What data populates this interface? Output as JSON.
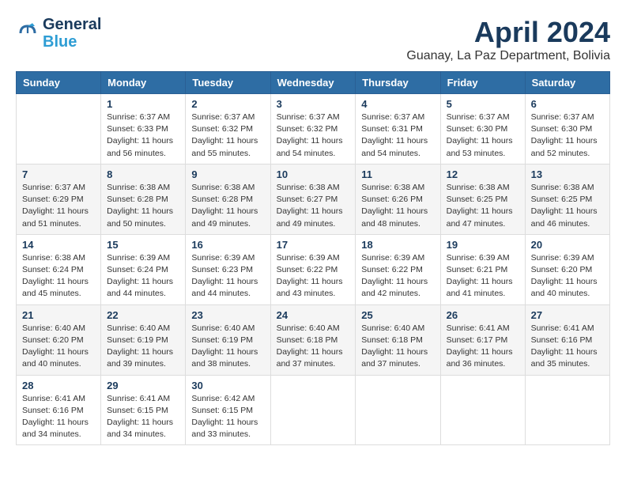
{
  "logo": {
    "line1": "General",
    "line2": "Blue"
  },
  "title": "April 2024",
  "location": "Guanay, La Paz Department, Bolivia",
  "days_of_week": [
    "Sunday",
    "Monday",
    "Tuesday",
    "Wednesday",
    "Thursday",
    "Friday",
    "Saturday"
  ],
  "weeks": [
    [
      {
        "day": "",
        "sunrise": "",
        "sunset": "",
        "daylight": ""
      },
      {
        "day": "1",
        "sunrise": "Sunrise: 6:37 AM",
        "sunset": "Sunset: 6:33 PM",
        "daylight": "Daylight: 11 hours and 56 minutes."
      },
      {
        "day": "2",
        "sunrise": "Sunrise: 6:37 AM",
        "sunset": "Sunset: 6:32 PM",
        "daylight": "Daylight: 11 hours and 55 minutes."
      },
      {
        "day": "3",
        "sunrise": "Sunrise: 6:37 AM",
        "sunset": "Sunset: 6:32 PM",
        "daylight": "Daylight: 11 hours and 54 minutes."
      },
      {
        "day": "4",
        "sunrise": "Sunrise: 6:37 AM",
        "sunset": "Sunset: 6:31 PM",
        "daylight": "Daylight: 11 hours and 54 minutes."
      },
      {
        "day": "5",
        "sunrise": "Sunrise: 6:37 AM",
        "sunset": "Sunset: 6:30 PM",
        "daylight": "Daylight: 11 hours and 53 minutes."
      },
      {
        "day": "6",
        "sunrise": "Sunrise: 6:37 AM",
        "sunset": "Sunset: 6:30 PM",
        "daylight": "Daylight: 11 hours and 52 minutes."
      }
    ],
    [
      {
        "day": "7",
        "sunrise": "Sunrise: 6:37 AM",
        "sunset": "Sunset: 6:29 PM",
        "daylight": "Daylight: 11 hours and 51 minutes."
      },
      {
        "day": "8",
        "sunrise": "Sunrise: 6:38 AM",
        "sunset": "Sunset: 6:28 PM",
        "daylight": "Daylight: 11 hours and 50 minutes."
      },
      {
        "day": "9",
        "sunrise": "Sunrise: 6:38 AM",
        "sunset": "Sunset: 6:28 PM",
        "daylight": "Daylight: 11 hours and 49 minutes."
      },
      {
        "day": "10",
        "sunrise": "Sunrise: 6:38 AM",
        "sunset": "Sunset: 6:27 PM",
        "daylight": "Daylight: 11 hours and 49 minutes."
      },
      {
        "day": "11",
        "sunrise": "Sunrise: 6:38 AM",
        "sunset": "Sunset: 6:26 PM",
        "daylight": "Daylight: 11 hours and 48 minutes."
      },
      {
        "day": "12",
        "sunrise": "Sunrise: 6:38 AM",
        "sunset": "Sunset: 6:25 PM",
        "daylight": "Daylight: 11 hours and 47 minutes."
      },
      {
        "day": "13",
        "sunrise": "Sunrise: 6:38 AM",
        "sunset": "Sunset: 6:25 PM",
        "daylight": "Daylight: 11 hours and 46 minutes."
      }
    ],
    [
      {
        "day": "14",
        "sunrise": "Sunrise: 6:38 AM",
        "sunset": "Sunset: 6:24 PM",
        "daylight": "Daylight: 11 hours and 45 minutes."
      },
      {
        "day": "15",
        "sunrise": "Sunrise: 6:39 AM",
        "sunset": "Sunset: 6:24 PM",
        "daylight": "Daylight: 11 hours and 44 minutes."
      },
      {
        "day": "16",
        "sunrise": "Sunrise: 6:39 AM",
        "sunset": "Sunset: 6:23 PM",
        "daylight": "Daylight: 11 hours and 44 minutes."
      },
      {
        "day": "17",
        "sunrise": "Sunrise: 6:39 AM",
        "sunset": "Sunset: 6:22 PM",
        "daylight": "Daylight: 11 hours and 43 minutes."
      },
      {
        "day": "18",
        "sunrise": "Sunrise: 6:39 AM",
        "sunset": "Sunset: 6:22 PM",
        "daylight": "Daylight: 11 hours and 42 minutes."
      },
      {
        "day": "19",
        "sunrise": "Sunrise: 6:39 AM",
        "sunset": "Sunset: 6:21 PM",
        "daylight": "Daylight: 11 hours and 41 minutes."
      },
      {
        "day": "20",
        "sunrise": "Sunrise: 6:39 AM",
        "sunset": "Sunset: 6:20 PM",
        "daylight": "Daylight: 11 hours and 40 minutes."
      }
    ],
    [
      {
        "day": "21",
        "sunrise": "Sunrise: 6:40 AM",
        "sunset": "Sunset: 6:20 PM",
        "daylight": "Daylight: 11 hours and 40 minutes."
      },
      {
        "day": "22",
        "sunrise": "Sunrise: 6:40 AM",
        "sunset": "Sunset: 6:19 PM",
        "daylight": "Daylight: 11 hours and 39 minutes."
      },
      {
        "day": "23",
        "sunrise": "Sunrise: 6:40 AM",
        "sunset": "Sunset: 6:19 PM",
        "daylight": "Daylight: 11 hours and 38 minutes."
      },
      {
        "day": "24",
        "sunrise": "Sunrise: 6:40 AM",
        "sunset": "Sunset: 6:18 PM",
        "daylight": "Daylight: 11 hours and 37 minutes."
      },
      {
        "day": "25",
        "sunrise": "Sunrise: 6:40 AM",
        "sunset": "Sunset: 6:18 PM",
        "daylight": "Daylight: 11 hours and 37 minutes."
      },
      {
        "day": "26",
        "sunrise": "Sunrise: 6:41 AM",
        "sunset": "Sunset: 6:17 PM",
        "daylight": "Daylight: 11 hours and 36 minutes."
      },
      {
        "day": "27",
        "sunrise": "Sunrise: 6:41 AM",
        "sunset": "Sunset: 6:16 PM",
        "daylight": "Daylight: 11 hours and 35 minutes."
      }
    ],
    [
      {
        "day": "28",
        "sunrise": "Sunrise: 6:41 AM",
        "sunset": "Sunset: 6:16 PM",
        "daylight": "Daylight: 11 hours and 34 minutes."
      },
      {
        "day": "29",
        "sunrise": "Sunrise: 6:41 AM",
        "sunset": "Sunset: 6:15 PM",
        "daylight": "Daylight: 11 hours and 34 minutes."
      },
      {
        "day": "30",
        "sunrise": "Sunrise: 6:42 AM",
        "sunset": "Sunset: 6:15 PM",
        "daylight": "Daylight: 11 hours and 33 minutes."
      },
      {
        "day": "",
        "sunrise": "",
        "sunset": "",
        "daylight": ""
      },
      {
        "day": "",
        "sunrise": "",
        "sunset": "",
        "daylight": ""
      },
      {
        "day": "",
        "sunrise": "",
        "sunset": "",
        "daylight": ""
      },
      {
        "day": "",
        "sunrise": "",
        "sunset": "",
        "daylight": ""
      }
    ]
  ]
}
